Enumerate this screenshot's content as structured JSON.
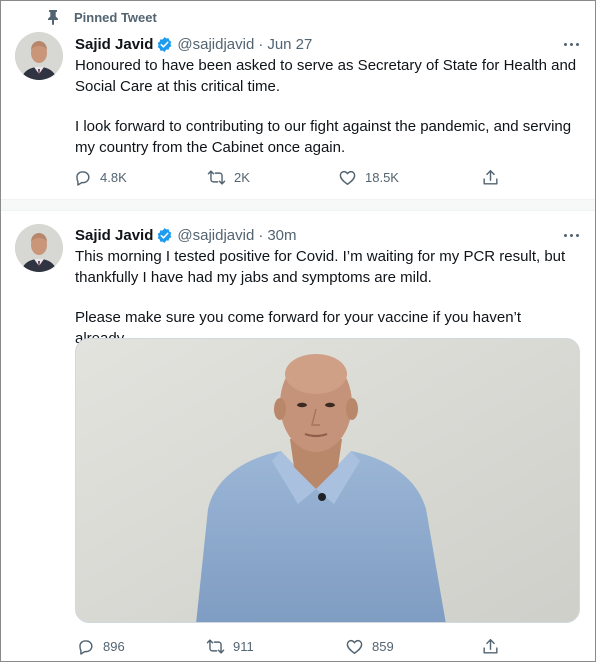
{
  "pinned_label": "Pinned Tweet",
  "tweets": [
    {
      "author_name": "Sajid Javid",
      "handle": "@sajidjavid",
      "separator": "·",
      "time": "Jun 27",
      "paragraphs": [
        "Honoured to have been asked to serve as Secretary of State for Health and Social Care at this critical time.",
        "I look forward to contributing to our fight against the pandemic, and serving my country from the Cabinet once again."
      ],
      "replies": "4.8K",
      "retweets": "2K",
      "likes": "18.5K"
    },
    {
      "author_name": "Sajid Javid",
      "handle": "@sajidjavid",
      "separator": "·",
      "time": "30m",
      "paragraphs": [
        "This morning I tested positive for Covid. I’m waiting for my PCR result, but thankfully I have had my jabs and symptoms are mild.",
        "Please make sure you come forward for your vaccine if you haven’t already."
      ],
      "replies": "896",
      "retweets": "911",
      "likes": "859"
    }
  ],
  "colors": {
    "text": "#0f1419",
    "secondary": "#536471",
    "verified": "#1d9bf0",
    "divider": "#eff3f4"
  }
}
